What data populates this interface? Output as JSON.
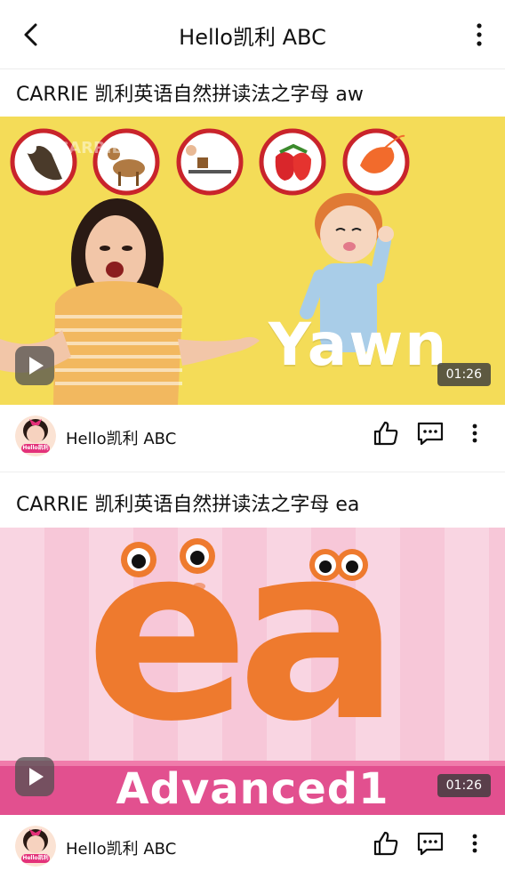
{
  "header": {
    "title": "Hello凯利 ABC"
  },
  "videos": [
    {
      "title": "CARRIE 凯利英语自然拼读法之字母 aw",
      "duration": "01:26",
      "thumb_word": "Yawn",
      "watermark": "CARRIE",
      "channel": "Hello凯利 ABC",
      "bg_color": "#f4dc58"
    },
    {
      "title": "CARRIE 凯利英语自然拼读法之字母 ea",
      "duration": "01:26",
      "thumb_word": "ea",
      "banner": "Advanced1",
      "channel": "Hello凯利 ABC",
      "bg_color": "#f7c7d8"
    }
  ],
  "avatar_badge": "Hello凯利",
  "icons": [
    "back-arrow-icon",
    "more-vertical-icon",
    "play-icon",
    "thumbs-up-icon",
    "comment-icon"
  ]
}
